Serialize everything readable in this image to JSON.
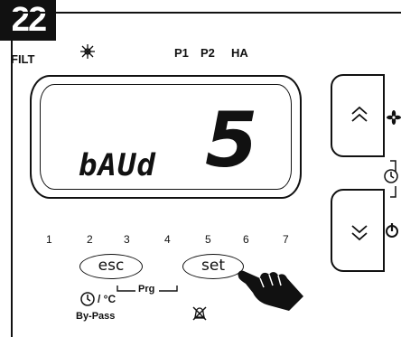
{
  "step_badge": "22",
  "top_indicators": {
    "filt": "FILT",
    "defrost_icon": "snowflake-icon",
    "p1": "P1",
    "p2": "P2",
    "ha": "HA"
  },
  "display": {
    "parameter_code": "bAUd",
    "value": "5"
  },
  "side_icons": {
    "fan": "fan-icon",
    "clock": "clock-icon",
    "power": "power-icon"
  },
  "number_row": [
    "1",
    "2",
    "3",
    "4",
    "5",
    "6",
    "7"
  ],
  "buttons": {
    "esc": "esc",
    "set": "set"
  },
  "bottom_labels": {
    "clock_unit": "/ °C",
    "prg": "Prg",
    "bypass": "By-Pass",
    "alarm_mute_icon": "alarm-off-icon"
  },
  "colors": {
    "ink": "#111111",
    "background": "#ffffff"
  }
}
